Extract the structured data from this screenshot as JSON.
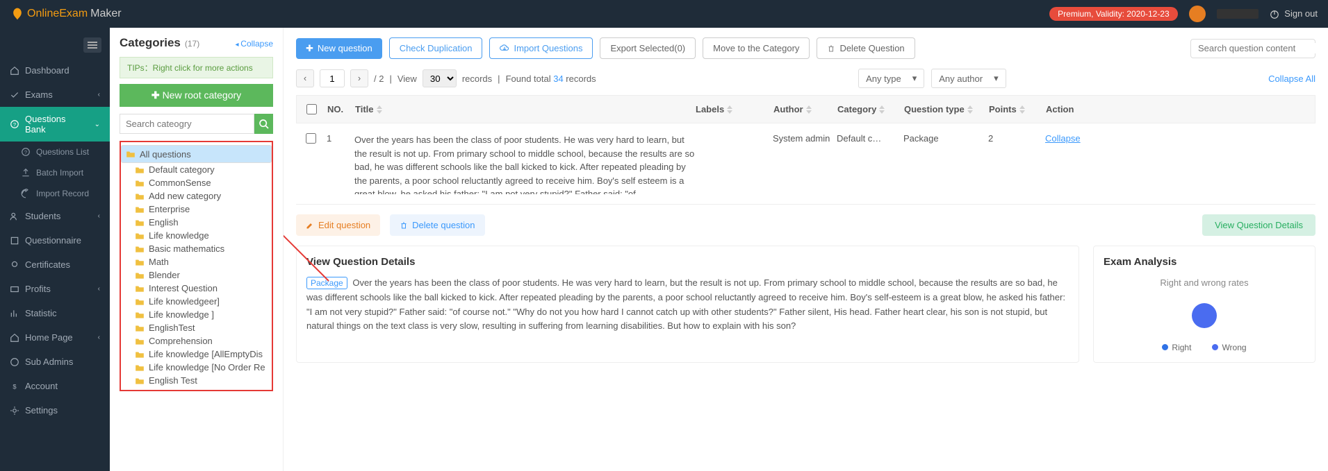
{
  "header": {
    "brand1": "OnlineExam",
    "brand2": "Maker",
    "premium_badge": "Premium, Validity: 2020-12-23",
    "signout": "Sign out"
  },
  "sidebar": {
    "items": [
      {
        "label": "Dashboard",
        "icon": "home"
      },
      {
        "label": "Exams",
        "icon": "check"
      },
      {
        "label": "Questions Bank",
        "icon": "help",
        "active": true,
        "subs": [
          {
            "label": "Questions List",
            "icon": "help"
          },
          {
            "label": "Batch Import",
            "icon": "upload"
          },
          {
            "label": "Import Record",
            "icon": "refresh"
          }
        ]
      },
      {
        "label": "Students",
        "icon": "users"
      },
      {
        "label": "Questionnaire",
        "icon": "form"
      },
      {
        "label": "Certificates",
        "icon": "cert"
      },
      {
        "label": "Profits",
        "icon": "card"
      },
      {
        "label": "Statistic",
        "icon": "stats"
      },
      {
        "label": "Home Page",
        "icon": "home2"
      },
      {
        "label": "Sub Admins",
        "icon": "help2"
      },
      {
        "label": "Account",
        "icon": "money"
      },
      {
        "label": "Settings",
        "icon": "gear"
      }
    ]
  },
  "categories": {
    "title": "Categories",
    "count": "(17)",
    "collapse": "Collapse",
    "tip": "TIPs：Right click for more actions",
    "new_root": "New root category",
    "search_placeholder": "Search cateogry",
    "items": [
      "All questions",
      "Default category",
      "CommonSense",
      "Add new category",
      "Enterprise",
      "English",
      "Life knowledge",
      "Basic mathematics",
      "Math",
      "Blender",
      "Interest Question",
      "Life knowledgeer]",
      "Life knowledge ]",
      "EnglishTest",
      "Comprehension",
      "Life knowledge [AllEmptyDis",
      "Life knowledge [No Order Re",
      "English Test"
    ]
  },
  "toolbar": {
    "new_question": "New question",
    "check_dup": "Check Duplication",
    "import_q": "Import Questions",
    "export_sel": "Export Selected(0)",
    "move_cat": "Move to the Category",
    "delete_q": "Delete Question",
    "search_placeholder": "Search question content"
  },
  "pager": {
    "page": "1",
    "total": "/ 2",
    "sep": "|",
    "view": "View",
    "per": "30",
    "rec": "records",
    "sep2": "|",
    "found_prefix": "Found total ",
    "found_num": "34",
    "found_suffix": " records",
    "filter_type": "Any type",
    "filter_author": "Any author",
    "collapse_all": "Collapse All"
  },
  "table": {
    "headers": {
      "no": "NO.",
      "title": "Title",
      "labels": "Labels",
      "author": "Author",
      "category": "Category",
      "qtype": "Question type",
      "points": "Points",
      "action": "Action"
    },
    "row": {
      "no": "1",
      "title": "Over the years has been the class of poor students. He was very hard to learn, but the result is not up. From primary school to middle school, because the results are so bad, he was different schools like the ball kicked to kick. After repeated pleading by the parents, a poor school reluctantly agreed to receive him.\nBoy's self esteem is a great blow, he asked his father: \"I am not very stupid?\" Father said: \"of",
      "author": "System admin",
      "category": "Default c…",
      "qtype": "Package",
      "points": "2",
      "action": "Collapse"
    }
  },
  "actions": {
    "edit": "Edit question",
    "delete": "Delete question",
    "view": "View Question Details"
  },
  "details": {
    "title": "View Question Details",
    "tag": "Package",
    "body": "Over the years has been the class of poor students. He was very hard to learn, but the result is not up. From primary school to middle school, because the results are so bad, he was different schools like the ball kicked to kick. After repeated pleading by the parents, a poor school reluctantly agreed to receive him.\nBoy's self-esteem is a great blow, he asked his father: \"I am not very stupid?\" Father said: \"of course not.\" \"Why do not you how hard I cannot catch up with other students?\" Father silent, His head.\nFather heart clear, his son is not stupid, but natural things on the text class is very slow, resulting in suffering from learning disabilities. But how to explain with his son?"
  },
  "analysis": {
    "title": "Exam Analysis",
    "rate_title": "Right and wrong rates",
    "legend_right": "Right",
    "legend_wrong": "Wrong"
  },
  "chart_data": {
    "type": "pie",
    "title": "Right and wrong rates",
    "series": [
      {
        "name": "Right",
        "value": 0,
        "color": "#2f72e6"
      },
      {
        "name": "Wrong",
        "value": 100,
        "color": "#4a6cf0"
      }
    ]
  }
}
